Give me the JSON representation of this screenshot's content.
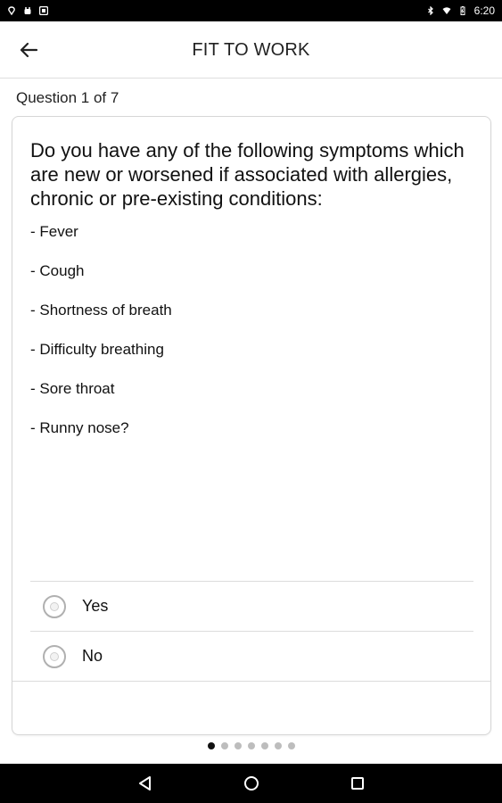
{
  "status_bar": {
    "time": "6:20",
    "left_icons": [
      "location-icon",
      "android-debug-icon",
      "photo-icon"
    ],
    "right_icons": [
      "bluetooth-icon",
      "wifi-icon",
      "battery-charging-icon"
    ]
  },
  "app_bar": {
    "title": "FIT TO WORK",
    "back_icon": "arrow-left-icon"
  },
  "progress": {
    "label": "Question 1 of 7",
    "current": 1,
    "total": 7
  },
  "question": {
    "text": "Do you have any of the following symptoms which are new or worsened if associated with allergies, chronic or pre-existing conditions:",
    "symptoms": [
      "- Fever",
      "- Cough",
      "- Shortness of breath",
      "- Difficulty breathing",
      "- Sore throat",
      "- Runny nose?"
    ]
  },
  "options": [
    {
      "label": "Yes",
      "selected": false
    },
    {
      "label": "No",
      "selected": false
    }
  ],
  "pager": {
    "count": 7,
    "active_index": 0
  },
  "nav_bar": {
    "icons": [
      "back-triangle-icon",
      "home-circle-icon",
      "recents-square-icon"
    ]
  },
  "colors": {
    "status_bar": "#000000",
    "active_dot": "#111111",
    "inactive_dot": "#bdbdbd",
    "divider": "#dcdcdc"
  }
}
